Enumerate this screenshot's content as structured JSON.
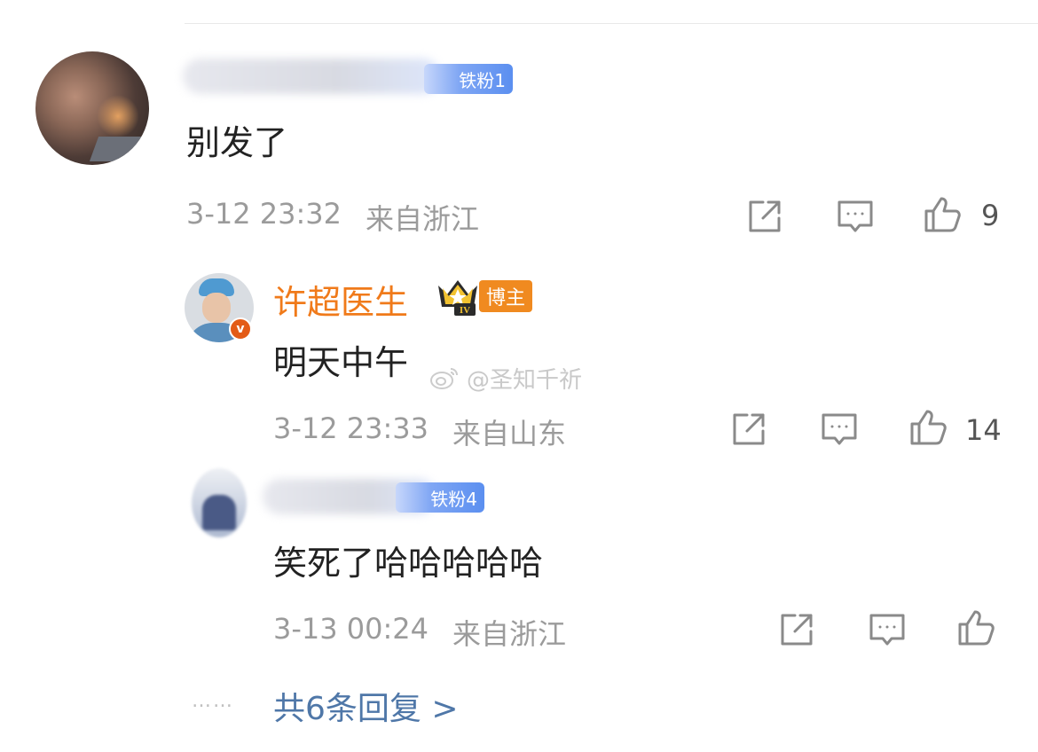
{
  "comment": {
    "badge_label": "铁粉1",
    "text": "别发了",
    "date": "3-12 23:32",
    "location": "来自浙江",
    "like_count": "9"
  },
  "replies": [
    {
      "author": "许超医生",
      "level_badge": "IV",
      "role_badge": "博主",
      "verified_mark": "v",
      "text": "明天中午",
      "date": "3-12 23:33",
      "location": "来自山东",
      "like_count": "14"
    },
    {
      "badge_label": "铁粉4",
      "text": "笑死了哈哈哈哈哈",
      "date": "3-13 00:24",
      "location": "来自浙江",
      "like_count": ""
    }
  ],
  "watermark": "@圣知千祈",
  "more_dots": "……",
  "more_replies": "共6条回复 >",
  "colors": {
    "author_orange": "#f07a1a",
    "link_blue": "#4f77a8",
    "fan_badge_blue": "#5b8ff0",
    "meta_gray": "#9b9b9b"
  },
  "icons": [
    "share-icon",
    "comment-icon",
    "like-icon",
    "crown-icon",
    "weibo-icon"
  ]
}
